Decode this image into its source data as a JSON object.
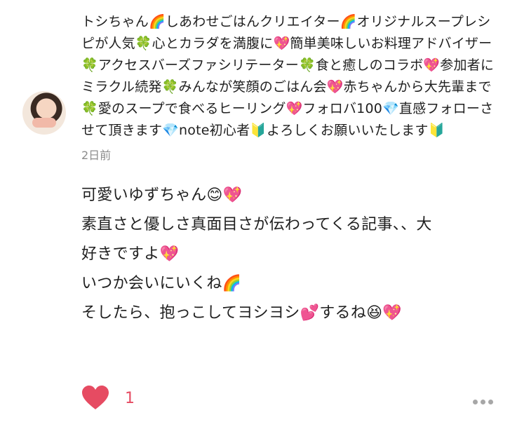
{
  "comment": {
    "profile_text": "トシちゃん🌈しあわせごはんクリエイター🌈オリジナルスープレシピが人気🍀心とカラダを満腹に💖簡単美味しいお料理アドバイザー🍀アクセスバーズファシリテーター🍀食と癒しのコラボ💖参加者にミラクル続発🍀みんなが笑顔のごはん会💖赤ちゃんから大先輩まで🍀愛のスープで食べるヒーリング💖フォロバ100💎直感フォローさせて頂きます💎note初心者🔰よろしくお願いいたします🔰",
    "timestamp": "2日前",
    "message_lines": [
      "可愛いゆずちゃん😊💖",
      "素直さと優しさ真面目さが伝わってくる記事、、大",
      "好きですよ💖",
      "いつか会いにいくね🌈",
      "そしたら、抱っこしてヨシヨシ💕するね😆💖"
    ]
  },
  "actions": {
    "like_count": "1",
    "like_color": "#e64b62"
  }
}
